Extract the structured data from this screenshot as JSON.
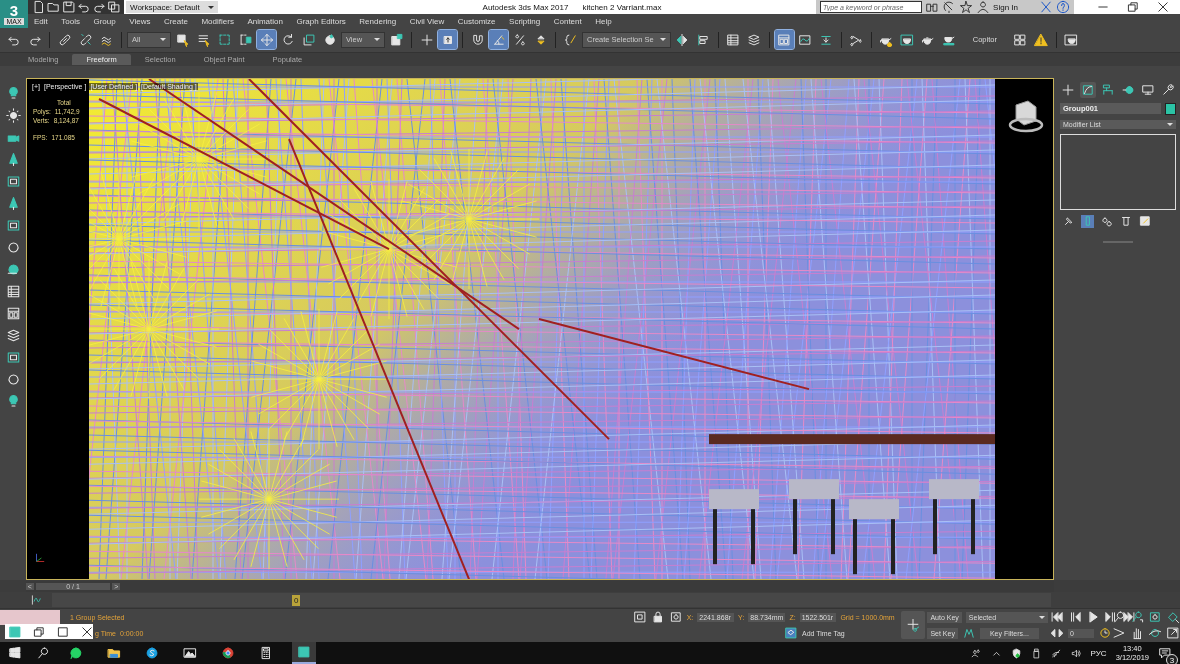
{
  "logo": {
    "mark": "3",
    "label": "MAX"
  },
  "title_bar": {
    "workspace": "Workspace: Default",
    "app_title": "Autodesk 3ds Max 2017",
    "file_name": "kitchen 2 Varriant.max",
    "search": {
      "placeholder": "Type a keyword or phrase"
    },
    "sign_in": "Sign In"
  },
  "menu": [
    "Edit",
    "Tools",
    "Group",
    "Views",
    "Create",
    "Modifiers",
    "Animation",
    "Graph Editors",
    "Rendering",
    "Civil View",
    "Customize",
    "Scripting",
    "Content",
    "Help"
  ],
  "toolbar_groups": [
    [
      {
        "kind": "undo",
        "selected": false
      },
      {
        "kind": "redo",
        "selected": false
      }
    ],
    [
      {
        "kind": "link",
        "selected": false
      },
      {
        "kind": "unlink",
        "selected": false
      },
      {
        "kind": "bind",
        "selected": false
      }
    ],
    [
      {
        "kind": "dropdown",
        "value": "All"
      },
      {
        "kind": "select",
        "selected": false
      },
      {
        "kind": "select-list",
        "selected": false
      },
      {
        "kind": "region",
        "selected": false
      },
      {
        "kind": "window",
        "selected": false
      },
      {
        "kind": "move",
        "selected": true
      },
      {
        "kind": "rotate",
        "selected": false
      },
      {
        "kind": "scale",
        "selected": false
      },
      {
        "kind": "placement",
        "selected": false
      },
      {
        "kind": "dropdown",
        "value": "View"
      },
      {
        "kind": "pivot",
        "selected": false
      }
    ],
    [
      {
        "kind": "cross",
        "selected": false
      },
      {
        "kind": "keyboard",
        "selected": true
      }
    ],
    [
      {
        "kind": "snap",
        "selected": false
      },
      {
        "kind": "angle",
        "selected": true
      },
      {
        "kind": "percent",
        "selected": false
      },
      {
        "kind": "spinner",
        "selected": false
      }
    ],
    [
      {
        "kind": "braces",
        "selected": false
      },
      {
        "kind": "dropdown",
        "value": "Create Selection Se"
      },
      {
        "kind": "mirror",
        "selected": false
      },
      {
        "kind": "align",
        "selected": false
      }
    ],
    [
      {
        "kind": "table",
        "selected": false
      },
      {
        "kind": "layers",
        "selected": false
      }
    ],
    [
      {
        "kind": "ribbon",
        "selected": true
      },
      {
        "kind": "curve",
        "selected": false
      },
      {
        "kind": "dope",
        "selected": false
      }
    ],
    [
      {
        "kind": "nodes",
        "selected": false
      }
    ],
    [
      {
        "kind": "teapot-gear",
        "selected": false
      },
      {
        "kind": "teapot-frame",
        "selected": false
      },
      {
        "kind": "teapot",
        "selected": false
      },
      {
        "kind": "teapot-cloud",
        "selected": false
      },
      {
        "kind": "label",
        "text": "Copitor"
      },
      {
        "kind": "grid4",
        "selected": false
      },
      {
        "kind": "warning",
        "selected": false
      }
    ],
    [
      {
        "kind": "teapot-window",
        "selected": false
      }
    ]
  ],
  "ribbon_tabs": [
    {
      "label": "Modeling",
      "selected": false
    },
    {
      "label": "Freeform",
      "selected": true
    },
    {
      "label": "Selection",
      "selected": false
    },
    {
      "label": "Object Paint",
      "selected": false
    },
    {
      "label": "Populate",
      "selected": false
    }
  ],
  "viewport": {
    "labels": [
      "[+]",
      "[Perspective ]",
      "[User Defined ]",
      "[Default Shading ]"
    ],
    "stats": {
      "header": "Total",
      "rows": [
        {
          "label": "Polys:",
          "value": "11,742,9"
        },
        {
          "label": "Verts:",
          "value": "8,124,87"
        },
        {
          "label": "FPS:",
          "value": "171.085"
        }
      ]
    }
  },
  "command_panel": {
    "tabs": [
      {
        "kind": "create",
        "selected": false
      },
      {
        "kind": "modify",
        "selected": true
      },
      {
        "kind": "hierarchy",
        "selected": false
      },
      {
        "kind": "motion",
        "selected": false
      },
      {
        "kind": "display",
        "selected": false
      },
      {
        "kind": "utilities",
        "selected": false
      }
    ],
    "object_name": "Group001",
    "modifier_list": "Modifier List",
    "stack_tools": [
      {
        "kind": "pin",
        "selected": false
      },
      {
        "kind": "bar",
        "selected": true
      },
      {
        "kind": "unique",
        "selected": false
      },
      {
        "kind": "trash",
        "selected": false
      },
      {
        "kind": "configure",
        "selected": false
      }
    ]
  },
  "time_slider": {
    "prev": "<",
    "position": "0 / 1",
    "next": ">",
    "level": 0
  },
  "track_bar": {
    "marker": "0"
  },
  "status": {
    "selection": "1 Group Selected",
    "render_time_label": "g Time",
    "render_time": "0:00:00",
    "x_label": "X:",
    "x": "2241.868r",
    "y_label": "Y:",
    "y": "88.734mm",
    "z_label": "Z:",
    "z": "1522.501r",
    "grid": "Grid = 1000.0mm",
    "add_time_tag": "Add Time Tag"
  },
  "animation": {
    "auto_key": "Auto Key",
    "key_mode": "Selected",
    "set_key": "Set Key",
    "key_filters": "Key Filters...",
    "frame": "0"
  },
  "taskbar": {
    "apps": [
      {
        "kind": "whatsapp",
        "selected": false
      },
      {
        "kind": "folder",
        "selected": false
      },
      {
        "kind": "skype",
        "selected": false
      },
      {
        "kind": "photos",
        "selected": false
      },
      {
        "kind": "chrome",
        "selected": false
      },
      {
        "kind": "calculator",
        "selected": false
      },
      {
        "kind": "max",
        "selected": true
      }
    ],
    "language": "РУС",
    "time": "13:40",
    "date": "3/12/2019",
    "notifications": "3"
  }
}
